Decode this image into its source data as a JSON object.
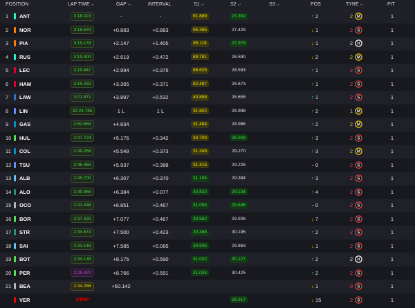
{
  "header": {
    "position": "POSITION",
    "lap_time": "LAP TIME",
    "gap": "GAP",
    "interval": "INTERVAL",
    "s1": "S1",
    "s2": "S2",
    "s3": "S3",
    "pos": "POS",
    "tyre": "TYRE",
    "pit": "PIT",
    "chevron": "⌵"
  },
  "colors": {
    "background": "#15151e",
    "green": "#41d84a",
    "yellow": "#f0e000",
    "purple": "#d24be8",
    "stop_red": "#e10600"
  },
  "rows": [
    {
      "pos": "1",
      "driver": "ANT",
      "team_color": "#27f4d2",
      "lap": "3:18.023",
      "lap_style": "green",
      "gap": "-",
      "interval": "-",
      "s1": "91.889",
      "s1_style": "yellow",
      "s2": "27.352",
      "s2_style": "green",
      "pos_dir": "up",
      "pos_change": "2",
      "tyre_age": "2",
      "tyre_age_style": "yellow",
      "tyre": "M",
      "tyre_color": "#f0d000",
      "pit": "1"
    },
    {
      "pos": "2",
      "driver": "NOR",
      "team_color": "#ff8000",
      "lap": "3:18.679",
      "lap_style": "green",
      "gap": "+0.883",
      "interval": "+0.883",
      "s1": "95.385",
      "s1_style": "yellow",
      "s2": "27.429",
      "s2_style": "white",
      "pos_dir": "down",
      "pos_change": "1",
      "tyre_age": "2",
      "tyre_age_style": "red",
      "tyre": "S",
      "tyre_color": "#e8444a",
      "pit": "1"
    },
    {
      "pos": "3",
      "driver": "PIA",
      "team_color": "#ff8000",
      "lap": "3:19.178",
      "lap_style": "green",
      "gap": "+2.147",
      "interval": "+1.405",
      "s1": "85.116",
      "s1_style": "yellow",
      "s2": "27.978",
      "s2_style": "green",
      "pos_dir": "down",
      "pos_change": "1",
      "tyre_age": "2",
      "tyre_age_style": "white",
      "tyre": "H",
      "tyre_color": "#ffffff",
      "pit": "1"
    },
    {
      "pos": "4",
      "driver": "RUS",
      "team_color": "#27f4d2",
      "lap": "3:19.300",
      "lap_style": "green",
      "gap": "+2.619",
      "interval": "+0.472",
      "s1": "89.781",
      "s1_style": "yellow",
      "s2": "28.590",
      "s2_style": "white",
      "pos_dir": "down",
      "pos_change": "2",
      "tyre_age": "2",
      "tyre_age_style": "yellow",
      "tyre": "M",
      "tyre_color": "#f0d000",
      "pit": "1"
    },
    {
      "pos": "5",
      "driver": "LEC",
      "team_color": "#e8002d",
      "lap": "3:19.647",
      "lap_style": "green",
      "gap": "+2.994",
      "interval": "+0.375",
      "s1": "86.625",
      "s1_style": "yellow",
      "s2": "28.593",
      "s2_style": "white",
      "pos_dir": "up",
      "pos_change": "1",
      "tyre_age": "2",
      "tyre_age_style": "red",
      "tyre": "S",
      "tyre_color": "#e8444a",
      "pit": "1"
    },
    {
      "pos": "6",
      "driver": "HAM",
      "team_color": "#e8002d",
      "lap": "3:19.032",
      "lap_style": "green",
      "gap": "+3.365",
      "interval": "+0.371",
      "s1": "82.487",
      "s1_style": "yellow",
      "s2": "28.673",
      "s2_style": "white",
      "pos_dir": "up",
      "pos_change": "1",
      "tyre_age": "2",
      "tyre_age_style": "red",
      "tyre": "S",
      "tyre_color": "#e8444a",
      "pit": "1"
    },
    {
      "pos": "7",
      "driver": "LAW",
      "team_color": "#3671c6",
      "lap": "3:01.971",
      "lap_style": "green",
      "gap": "+3.897",
      "interval": "+0.532",
      "s1": "40.858",
      "s1_style": "yellow",
      "s2": "28.655",
      "s2_style": "white",
      "pos_dir": "up",
      "pos_change": "1",
      "tyre_age": "2",
      "tyre_age_style": "red",
      "tyre": "S",
      "tyre_color": "#e8444a",
      "pit": "1"
    },
    {
      "pos": "8",
      "driver": "LIN",
      "team_color": "#6692ff",
      "lap": "32:24.785",
      "lap_style": "green",
      "gap": "1 L",
      "interval": "1 L",
      "s1": "31.802",
      "s1_style": "yellow",
      "s2": "28.998",
      "s2_style": "white",
      "pos_dir": "up",
      "pos_change": "2",
      "tyre_age": "1",
      "tyre_age_style": "yellow",
      "tyre": "M",
      "tyre_color": "#f0d000",
      "pit": "1"
    },
    {
      "pos": "9",
      "driver": "GAS",
      "team_color": "#0093cc",
      "lap": "2:50.655",
      "lap_style": "green",
      "gap": "+4.834",
      "interval": "",
      "s1": "31.494",
      "s1_style": "yellow",
      "s2": "28.986",
      "s2_style": "white",
      "pos_dir": "up",
      "pos_change": "2",
      "tyre_age": "2",
      "tyre_age_style": "yellow",
      "tyre": "M",
      "tyre_color": "#f0d000",
      "pit": "1"
    },
    {
      "pos": "10",
      "driver": "HUL",
      "team_color": "#52e252",
      "lap": "2:47.724",
      "lap_style": "green",
      "gap": "+5.176",
      "interval": "+0.342",
      "s1": "30.700",
      "s1_style": "yellow",
      "s2": "28.909",
      "s2_style": "green",
      "pos_dir": "up",
      "pos_change": "3",
      "tyre_age": "2",
      "tyre_age_style": "red",
      "tyre": "S",
      "tyre_color": "#e8444a",
      "pit": "1"
    },
    {
      "pos": "11",
      "driver": "COL",
      "team_color": "#0093cc",
      "lap": "2:49.258",
      "lap_style": "green",
      "gap": "+5.549",
      "interval": "+0.373",
      "s1": "31.349",
      "s1_style": "yellow",
      "s2": "29.270",
      "s2_style": "white",
      "pos_dir": "up",
      "pos_change": "3",
      "tyre_age": "2",
      "tyre_age_style": "yellow",
      "tyre": "M",
      "tyre_color": "#f0d000",
      "pit": "1"
    },
    {
      "pos": "12",
      "driver": "TSU",
      "team_color": "#6692ff",
      "lap": "2:46.465",
      "lap_style": "green",
      "gap": "+5.937",
      "interval": "+0.388",
      "s1": "31.415",
      "s1_style": "yellow",
      "s2": "29.226",
      "s2_style": "white",
      "pos_dir": "same",
      "pos_change": "0",
      "tyre_age": "2",
      "tyre_age_style": "red",
      "tyre": "S",
      "tyre_color": "#e8444a",
      "pit": "1"
    },
    {
      "pos": "13",
      "driver": "ALB",
      "team_color": "#64c4ff",
      "lap": "2:45.700",
      "lap_style": "green",
      "gap": "+6.307",
      "interval": "+0.370",
      "s1": "31.194",
      "s1_style": "green",
      "s2": "29.384",
      "s2_style": "white",
      "pos_dir": "up",
      "pos_change": "3",
      "tyre_age": "2",
      "tyre_age_style": "red",
      "tyre": "S",
      "tyre_color": "#e8444a",
      "pit": "1"
    },
    {
      "pos": "14",
      "driver": "ALO",
      "team_color": "#229971",
      "lap": "2:39.966",
      "lap_style": "green",
      "gap": "+6.384",
      "interval": "+0.077",
      "s1": "30.822",
      "s1_style": "green",
      "s2": "29.134",
      "s2_style": "green",
      "pos_dir": "up",
      "pos_change": "4",
      "tyre_age": "2",
      "tyre_age_style": "red",
      "tyre": "S",
      "tyre_color": "#e8444a",
      "pit": "1"
    },
    {
      "pos": "15",
      "driver": "OCO",
      "team_color": "#b6babd",
      "lap": "2:43.436",
      "lap_style": "green",
      "gap": "+6.851",
      "interval": "+0.467",
      "s1": "31.094",
      "s1_style": "green",
      "s2": "29.646",
      "s2_style": "green",
      "pos_dir": "same",
      "pos_change": "0",
      "tyre_age": "2",
      "tyre_age_style": "red",
      "tyre": "S",
      "tyre_color": "#e8444a",
      "pit": "1"
    },
    {
      "pos": "16",
      "driver": "BOR",
      "team_color": "#52e252",
      "lap": "2:37.325",
      "lap_style": "green",
      "gap": "+7.077",
      "interval": "+0.467",
      "s1": "30.582",
      "s1_style": "green",
      "s2": "29.926",
      "s2_style": "white",
      "pos_dir": "down",
      "pos_change": "7",
      "tyre_age": "2",
      "tyre_age_style": "red",
      "tyre": "S",
      "tyre_color": "#e8444a",
      "pit": "1"
    },
    {
      "pos": "17",
      "driver": "STR",
      "team_color": "#229971",
      "lap": "2:34.574",
      "lap_style": "green",
      "gap": "+7.500",
      "interval": "+0.423",
      "s1": "30.468",
      "s1_style": "green",
      "s2": "30.195",
      "s2_style": "white",
      "pos_dir": "up",
      "pos_change": "2",
      "tyre_age": "2",
      "tyre_age_style": "red",
      "tyre": "S",
      "tyre_color": "#e8444a",
      "pit": "1"
    },
    {
      "pos": "18",
      "driver": "SAI",
      "team_color": "#64c4ff",
      "lap": "2:33.145",
      "lap_style": "green",
      "gap": "+7.585",
      "interval": "+0.085",
      "s1": "30.935",
      "s1_style": "green",
      "s2": "29.863",
      "s2_style": "white",
      "pos_dir": "down",
      "pos_change": "1",
      "tyre_age": "2",
      "tyre_age_style": "red",
      "tyre": "S",
      "tyre_color": "#e8444a",
      "pit": "1"
    },
    {
      "pos": "19",
      "driver": "BOT",
      "team_color": "#52e252",
      "lap": "2:34.139",
      "lap_style": "green",
      "gap": "+8.175",
      "interval": "+0.590",
      "s1": "31.032",
      "s1_style": "green",
      "s2": "30.127",
      "s2_style": "green",
      "pos_dir": "up",
      "pos_change": "2",
      "tyre_age": "2",
      "tyre_age_style": "white",
      "tyre": "H",
      "tyre_color": "#ffffff",
      "pit": "1"
    },
    {
      "pos": "20",
      "driver": "PER",
      "team_color": "#52e252",
      "lap": "2:25.470",
      "lap_style": "purple",
      "gap": "+8.766",
      "interval": "+0.591",
      "s1": "31.034",
      "s1_style": "green",
      "s2": "30.425",
      "s2_style": "white",
      "pos_dir": "up",
      "pos_change": "2",
      "tyre_age": "2",
      "tyre_age_style": "red",
      "tyre": "S",
      "tyre_color": "#e8444a",
      "pit": "1"
    },
    {
      "pos": "21",
      "driver": "BEA",
      "team_color": "#b6babd",
      "lap": "2:34.256",
      "lap_style": "yellow",
      "gap": "+50.142",
      "interval": "",
      "s1": "",
      "s1_style": "white",
      "s2": "",
      "s2_style": "white",
      "pos_dir": "down",
      "pos_change": "1",
      "tyre_age": "0",
      "tyre_age_style": "red",
      "tyre": "S",
      "tyre_color": "#e8444a",
      "pit": "1"
    },
    {
      "pos": "",
      "driver": "VER",
      "team_color": "#e10600",
      "lap": "STOP",
      "lap_style": "stop",
      "gap": "",
      "interval": "",
      "s1": "",
      "s1_style": "white",
      "s2": "28.317",
      "s2_style": "green",
      "pos_dir": "down",
      "pos_change": "15",
      "tyre_age": "2",
      "tyre_age_style": "red",
      "tyre": "S",
      "tyre_color": "#e8444a",
      "pit": "1"
    }
  ]
}
